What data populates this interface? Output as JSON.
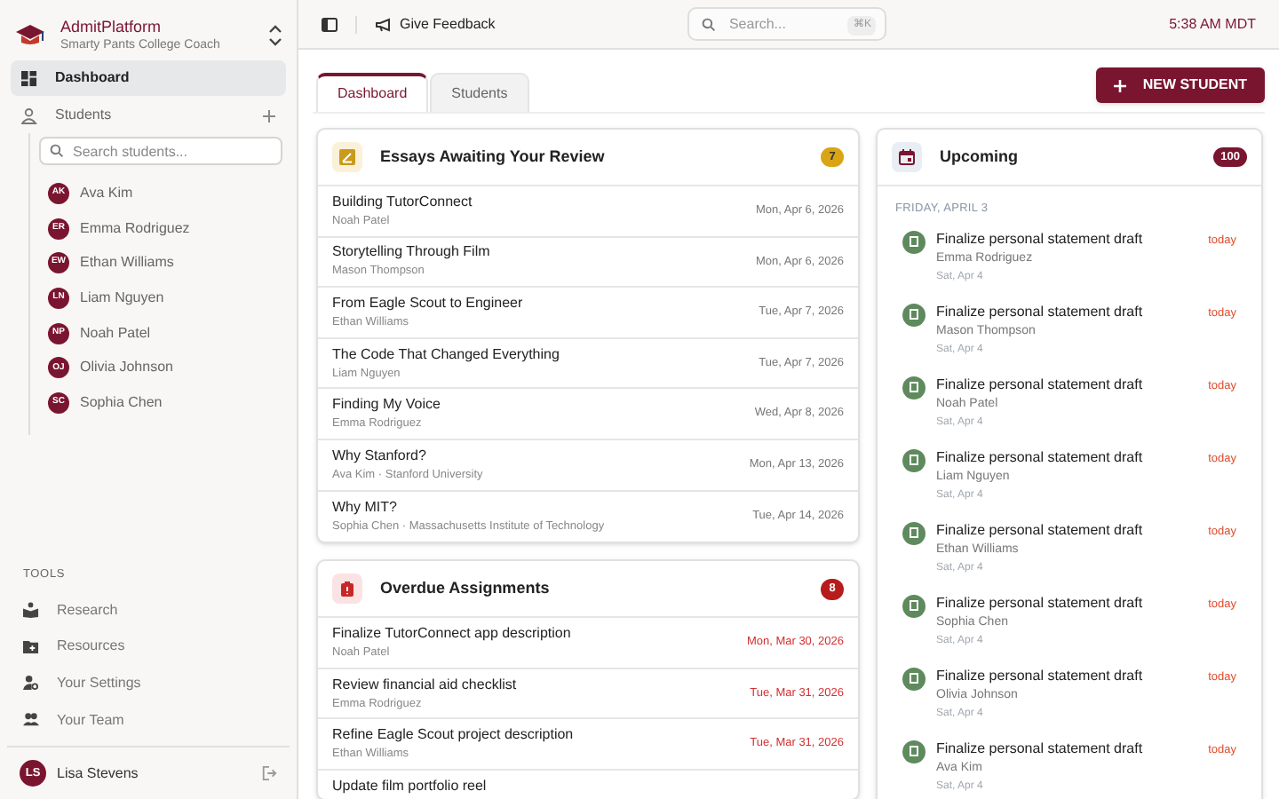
{
  "brand": {
    "name": "AdmitPlatform",
    "subtitle": "Smarty Pants College Coach"
  },
  "nav": [
    {
      "label": "Dashboard",
      "selected": true
    },
    {
      "label": "Students",
      "selected": false
    }
  ],
  "student_search": {
    "placeholder": "Search students..."
  },
  "students": [
    {
      "initials": "AK",
      "name": "Ava Kim"
    },
    {
      "initials": "ER",
      "name": "Emma Rodriguez"
    },
    {
      "initials": "EW",
      "name": "Ethan Williams"
    },
    {
      "initials": "LN",
      "name": "Liam Nguyen"
    },
    {
      "initials": "NP",
      "name": "Noah Patel"
    },
    {
      "initials": "OJ",
      "name": "Olivia Johnson"
    },
    {
      "initials": "SC",
      "name": "Sophia Chen"
    }
  ],
  "tools": {
    "heading": "TOOLS",
    "items": [
      {
        "label": "Research"
      },
      {
        "label": "Resources"
      },
      {
        "label": "Your Settings"
      },
      {
        "label": "Your Team"
      }
    ]
  },
  "user": {
    "initials": "LS",
    "name": "Lisa Stevens"
  },
  "topbar": {
    "feedback": "Give Feedback",
    "search_placeholder": "Search...",
    "shortcut": "⌘K",
    "time": "5:38 AM MDT"
  },
  "tabs": [
    {
      "label": "Dashboard",
      "selected": true
    },
    {
      "label": "Students",
      "selected": false
    }
  ],
  "new_student_button": "NEW STUDENT",
  "essays": {
    "title": "Essays Awaiting Your Review",
    "count": "7",
    "rows": [
      {
        "title": "Building TutorConnect",
        "subtitle": "Noah Patel",
        "date": "Mon, Apr 6, 2026"
      },
      {
        "title": "Storytelling Through Film",
        "subtitle": "Mason Thompson",
        "date": "Mon, Apr 6, 2026"
      },
      {
        "title": "From Eagle Scout to Engineer",
        "subtitle": "Ethan Williams",
        "date": "Tue, Apr 7, 2026"
      },
      {
        "title": "The Code That Changed Everything",
        "subtitle": "Liam Nguyen",
        "date": "Tue, Apr 7, 2026"
      },
      {
        "title": "Finding My Voice",
        "subtitle": "Emma Rodriguez",
        "date": "Wed, Apr 8, 2026"
      },
      {
        "title": "Why Stanford?",
        "subtitle": "Ava Kim · Stanford University",
        "date": "Mon, Apr 13, 2026"
      },
      {
        "title": "Why MIT?",
        "subtitle": "Sophia Chen · Massachusetts Institute of Technology",
        "date": "Tue, Apr 14, 2026"
      }
    ]
  },
  "overdue": {
    "title": "Overdue Assignments",
    "count": "8",
    "rows": [
      {
        "title": "Finalize TutorConnect app description",
        "subtitle": "Noah Patel",
        "date": "Mon, Mar 30, 2026"
      },
      {
        "title": "Review financial aid checklist",
        "subtitle": "Emma Rodriguez",
        "date": "Tue, Mar 31, 2026"
      },
      {
        "title": "Refine Eagle Scout project description",
        "subtitle": "Ethan Williams",
        "date": "Tue, Mar 31, 2026"
      },
      {
        "title": "Update film portfolio reel"
      }
    ]
  },
  "upcoming": {
    "title": "Upcoming",
    "count": "100",
    "day": "FRIDAY, APRIL 3",
    "items": [
      {
        "title": "Finalize personal statement draft",
        "student": "Emma Rodriguez",
        "date": "Sat, Apr 4",
        "when": "today"
      },
      {
        "title": "Finalize personal statement draft",
        "student": "Mason Thompson",
        "date": "Sat, Apr 4",
        "when": "today"
      },
      {
        "title": "Finalize personal statement draft",
        "student": "Noah Patel",
        "date": "Sat, Apr 4",
        "when": "today"
      },
      {
        "title": "Finalize personal statement draft",
        "student": "Liam Nguyen",
        "date": "Sat, Apr 4",
        "when": "today"
      },
      {
        "title": "Finalize personal statement draft",
        "student": "Ethan Williams",
        "date": "Sat, Apr 4",
        "when": "today"
      },
      {
        "title": "Finalize personal statement draft",
        "student": "Sophia Chen",
        "date": "Sat, Apr 4",
        "when": "today"
      },
      {
        "title": "Finalize personal statement draft",
        "student": "Olivia Johnson",
        "date": "Sat, Apr 4",
        "when": "today"
      },
      {
        "title": "Finalize personal statement draft",
        "student": "Ava Kim",
        "date": "Sat, Apr 4",
        "when": "today"
      }
    ]
  }
}
